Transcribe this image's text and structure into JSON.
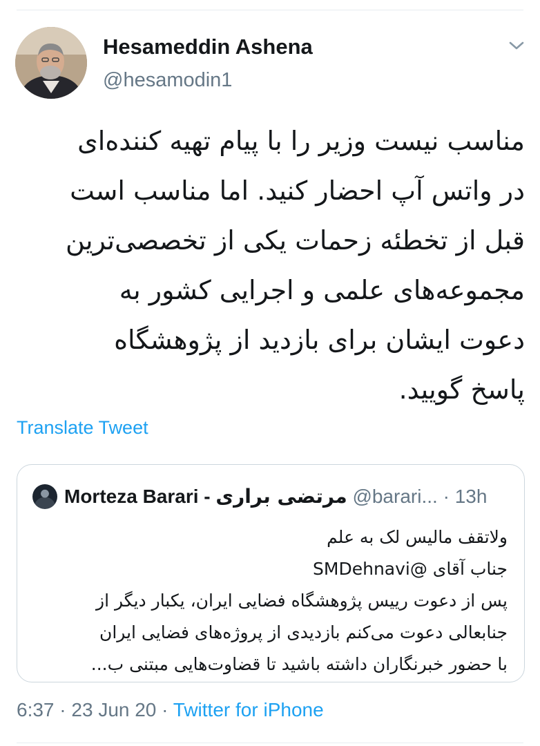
{
  "author": {
    "name": "Hesameddin Ashena",
    "handle": "@hesamodin1"
  },
  "tweet": {
    "lines": [
      "مناسب نیست وزیر را  با پیام تهیه کننده‌ای",
      "در واتس آپ احضار کنید. اما مناسب است",
      "قبل از تخطئه زحمات یکی از تخصصی‌ترین",
      "مجموعه‌های علمی و اجرایی کشور به",
      "دعوت ایشان برای بازدید از پژوهشگاه",
      "پاسخ گویید."
    ],
    "translate_label": "Translate Tweet"
  },
  "quoted": {
    "name": "Morteza Barari -",
    "name_fa": "مرتضی براری",
    "handle": "@barari...",
    "separator": "·",
    "time": "13h",
    "lines": [
      "ولاتقف مالیس لک به علم",
      "جناب آقای @SMDehnavi",
      "پس از دعوت رییس پژوهشگاه فضایی ایران، یکبار دیگر از",
      "جنابعالی دعوت می‌کنم بازدیدی از پروژه‌های فضایی ایران",
      "با حضور خبرنگاران داشته باشید تا قضاوت‌هایی مبتنی ب..."
    ]
  },
  "footer": {
    "time": "6:37",
    "separator1": " · ",
    "date": "23 Jun 20",
    "separator2": " · ",
    "source": "Twitter for iPhone"
  },
  "icons": {
    "menu": "chevron-down-icon"
  },
  "colors": {
    "link": "#1da1f2",
    "secondary_text": "#657786",
    "border": "#ccd6dd"
  }
}
